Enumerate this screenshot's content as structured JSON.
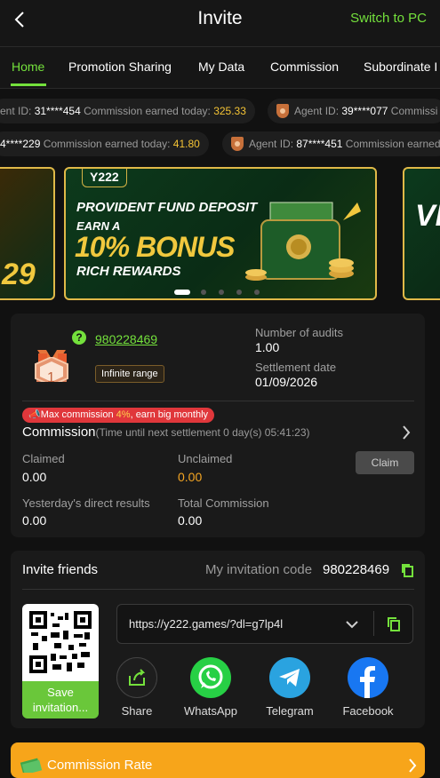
{
  "header": {
    "title": "Invite",
    "switch_label": "Switch to PC"
  },
  "tabs": [
    "Home",
    "Promotion Sharing",
    "My Data",
    "Commission",
    "Subordinate I"
  ],
  "ticker_row1": [
    {
      "label": "ent ID:",
      "id": "31****454",
      "earned_label": "Commission earned today:",
      "amount": "325.33"
    },
    {
      "label": "Agent ID:",
      "id": "39****077",
      "earned_label": "Commissi",
      "amount": ""
    }
  ],
  "ticker_row2": [
    {
      "label": "",
      "id": "4****229",
      "earned_label": "Commission earned today:",
      "amount": "41.80"
    },
    {
      "label": "Agent ID:",
      "id": "87****451",
      "earned_label": "Commission earned",
      "amount": ""
    }
  ],
  "banner": {
    "logo": "Y222",
    "line1": "PROVIDENT FUND DEPOSIT",
    "line2": "EARN A",
    "line3": "10% BONUS",
    "line4": "RICH REWARDS",
    "side_left_text": "29",
    "side_right_text": "VI"
  },
  "account": {
    "rank": "1",
    "uid": "980228469",
    "range_badge": "Infinite range",
    "audits_label": "Number of audits",
    "audits_value": "1.00",
    "settlement_label": "Settlement date",
    "settlement_value": "01/09/2026"
  },
  "commission": {
    "promo_prefix": "Max commission ",
    "promo_highlight": "4%",
    "promo_suffix": ", earn big monthly",
    "title": "Commission",
    "subtitle": "(Time until next settlement  0 day(s) 05:41:23)",
    "claimed_label": "Claimed",
    "claimed_value": "0.00",
    "unclaimed_label": "Unclaimed",
    "unclaimed_value": "0.00",
    "claim_button": "Claim",
    "yesterday_label": "Yesterday's direct results",
    "yesterday_value": "0.00",
    "total_label": "Total Commission",
    "total_value": "0.00"
  },
  "invite": {
    "title": "Invite friends",
    "code_label": "My invitation code",
    "code_value": "980228469",
    "save_label": "Save invitation...",
    "url": "https://y222.games/?dl=g7lp4l",
    "share": [
      {
        "label": "Share",
        "icon": "share-icon",
        "color": "#1e1e1e"
      },
      {
        "label": "WhatsApp",
        "icon": "whatsapp-icon",
        "color": "#27d045"
      },
      {
        "label": "Telegram",
        "icon": "telegram-icon",
        "color": "#2aa3e0"
      },
      {
        "label": "Facebook",
        "icon": "facebook-icon",
        "color": "#1877f2"
      }
    ]
  },
  "rate": {
    "label": "Commission Rate"
  },
  "colors": {
    "accent": "#74e13c",
    "gold": "#f5c435",
    "promo": "#e0373b",
    "rate_bar": "#f7a51a"
  }
}
